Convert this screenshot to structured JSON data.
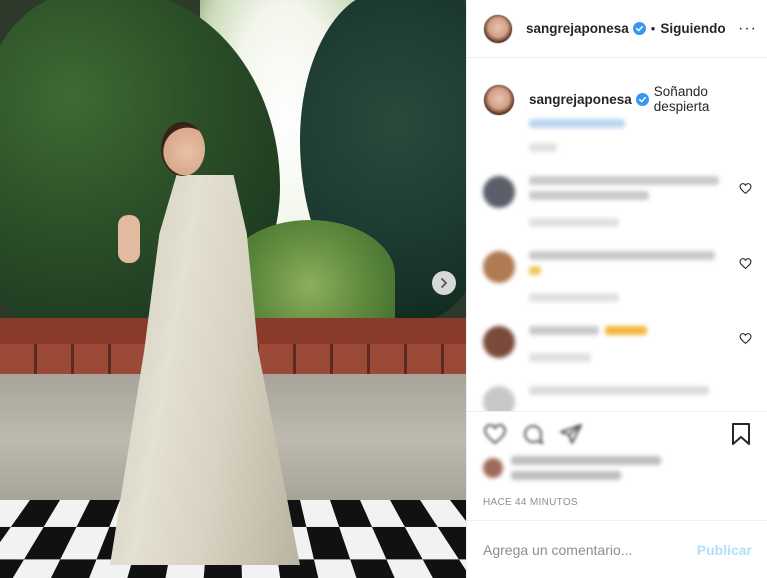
{
  "post": {
    "image_alt": "",
    "next_icon": "chevron-right-icon"
  },
  "header": {
    "username": "sangrejaponesa",
    "separator": "•",
    "follow_label": "Siguiendo",
    "more_label": "···"
  },
  "caption": {
    "username": "sangrejaponesa",
    "text": "Soñando despierta"
  },
  "comments": [
    {
      "avatar_color": "#5a5f6a"
    },
    {
      "avatar_color": "#b07a52"
    },
    {
      "avatar_color": "#7a4a3a"
    }
  ],
  "footer": {
    "time_label": "HACE 44 MINUTOS",
    "comment_placeholder": "Agrega un comentario...",
    "publish_label": "Publicar"
  },
  "colors": {
    "verified": "#3897f0",
    "publish_disabled": "#b2dffc",
    "muted": "#8e8e8e"
  }
}
